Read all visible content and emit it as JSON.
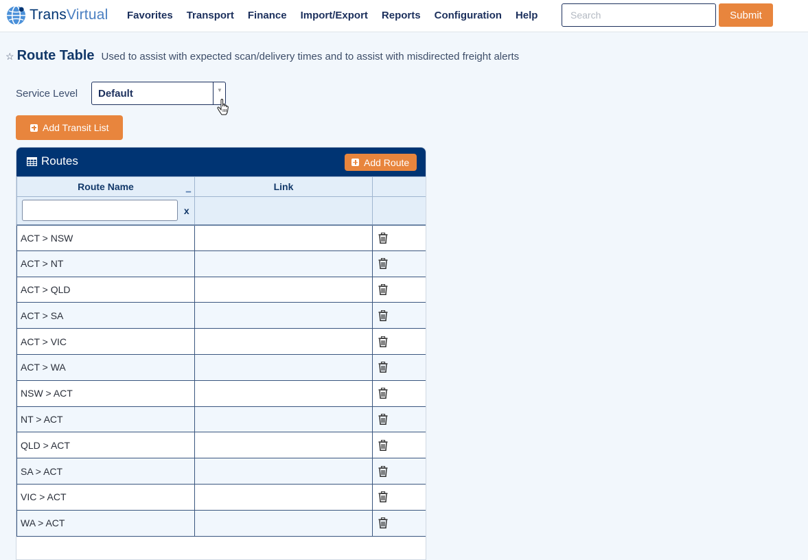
{
  "app": {
    "logo_prefix": "Trans",
    "logo_suffix": "Virtual"
  },
  "nav": {
    "items": [
      "Favorites",
      "Transport",
      "Finance",
      "Import/Export",
      "Reports",
      "Configuration",
      "Help"
    ]
  },
  "search": {
    "placeholder": "Search",
    "value": "",
    "submit_label": "Submit"
  },
  "page": {
    "title": "Route Table",
    "subtitle": "Used to assist with expected scan/delivery times and to assist with misdirected freight alerts"
  },
  "service_level": {
    "label": "Service Level",
    "selected": "Default"
  },
  "add_transit_label": "Add Transit List",
  "routes_panel": {
    "title": "Routes",
    "add_route_label": "Add Route",
    "columns": [
      "Route Name",
      "Link",
      ""
    ],
    "filter_clear": "x",
    "filter_value": "",
    "rows": [
      {
        "name": "ACT > NSW",
        "link": ""
      },
      {
        "name": "ACT > NT",
        "link": ""
      },
      {
        "name": "ACT > QLD",
        "link": ""
      },
      {
        "name": "ACT > SA",
        "link": ""
      },
      {
        "name": "ACT > VIC",
        "link": ""
      },
      {
        "name": "ACT > WA",
        "link": ""
      },
      {
        "name": "NSW > ACT",
        "link": ""
      },
      {
        "name": "NT > ACT",
        "link": ""
      },
      {
        "name": "QLD > ACT",
        "link": ""
      },
      {
        "name": "SA > ACT",
        "link": ""
      },
      {
        "name": "VIC > ACT",
        "link": ""
      },
      {
        "name": "WA > ACT",
        "link": ""
      }
    ]
  },
  "colors": {
    "accent_orange": "#e8853d",
    "navy": "#003473",
    "page_bg": "#f2f7fc"
  },
  "icons": [
    "globe-logo-icon",
    "star-icon",
    "grid-icon",
    "plus-square-icon",
    "trash-icon",
    "hand-pointer-icon"
  ]
}
